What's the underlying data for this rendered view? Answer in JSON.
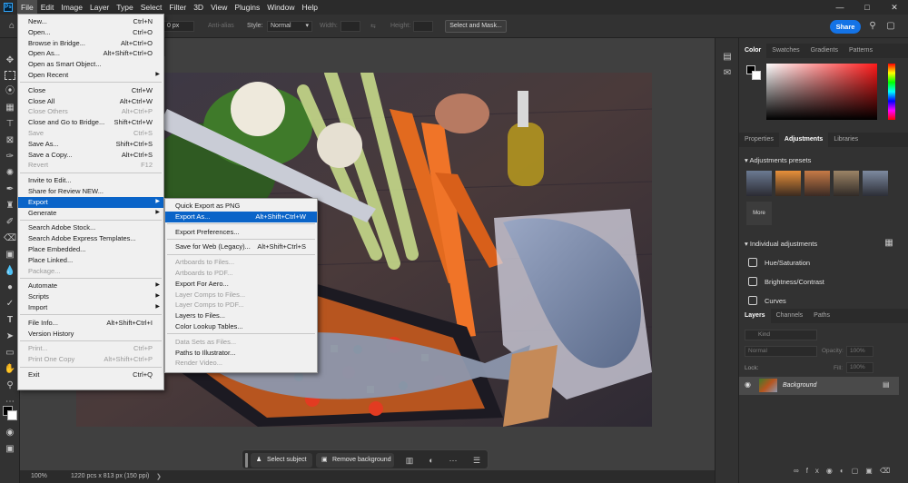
{
  "menubar": {
    "items": [
      "File",
      "Edit",
      "Image",
      "Layer",
      "Type",
      "Select",
      "Filter",
      "3D",
      "View",
      "Plugins",
      "Window",
      "Help"
    ],
    "active": "File"
  },
  "options_bar": {
    "feather_value": "0 px",
    "anti_alias": "Anti-alias",
    "style_label": "Style:",
    "style_value": "Normal",
    "width_label": "Width:",
    "height_label": "Height:",
    "select_mask": "Select and Mask...",
    "share": "Share"
  },
  "file_menu": [
    {
      "label": "New...",
      "key": "Ctrl+N"
    },
    {
      "label": "Open...",
      "key": "Ctrl+O"
    },
    {
      "label": "Browse in Bridge...",
      "key": "Alt+Ctrl+O"
    },
    {
      "label": "Open As...",
      "key": "Alt+Shift+Ctrl+O"
    },
    {
      "label": "Open as Smart Object..."
    },
    {
      "label": "Open Recent",
      "submenu": true
    },
    {
      "sep": true
    },
    {
      "label": "Close",
      "key": "Ctrl+W"
    },
    {
      "label": "Close All",
      "key": "Alt+Ctrl+W"
    },
    {
      "label": "Close Others",
      "key": "Alt+Ctrl+P",
      "disabled": true
    },
    {
      "label": "Close and Go to Bridge...",
      "key": "Shift+Ctrl+W"
    },
    {
      "label": "Save",
      "key": "Ctrl+S",
      "disabled": true
    },
    {
      "label": "Save As...",
      "key": "Shift+Ctrl+S"
    },
    {
      "label": "Save a Copy...",
      "key": "Alt+Ctrl+S"
    },
    {
      "label": "Revert",
      "key": "F12",
      "disabled": true
    },
    {
      "sep": true
    },
    {
      "label": "Invite to Edit..."
    },
    {
      "label": "Share for Review NEW..."
    },
    {
      "label": "Export",
      "submenu": true,
      "highlight": true
    },
    {
      "label": "Generate",
      "submenu": true
    },
    {
      "sep": true
    },
    {
      "label": "Search Adobe Stock..."
    },
    {
      "label": "Search Adobe Express Templates..."
    },
    {
      "label": "Place Embedded..."
    },
    {
      "label": "Place Linked..."
    },
    {
      "label": "Package...",
      "disabled": true
    },
    {
      "sep": true
    },
    {
      "label": "Automate",
      "submenu": true
    },
    {
      "label": "Scripts",
      "submenu": true
    },
    {
      "label": "Import",
      "submenu": true
    },
    {
      "sep": true
    },
    {
      "label": "File Info...",
      "key": "Alt+Shift+Ctrl+I"
    },
    {
      "label": "Version History"
    },
    {
      "sep": true
    },
    {
      "label": "Print...",
      "key": "Ctrl+P",
      "disabled": true
    },
    {
      "label": "Print One Copy",
      "key": "Alt+Shift+Ctrl+P",
      "disabled": true
    },
    {
      "sep": true
    },
    {
      "label": "Exit",
      "key": "Ctrl+Q"
    }
  ],
  "export_menu": [
    {
      "label": "Quick Export as PNG"
    },
    {
      "label": "Export As...",
      "key": "Alt+Shift+Ctrl+W",
      "highlight": true
    },
    {
      "sep": true
    },
    {
      "label": "Export Preferences..."
    },
    {
      "sep": true
    },
    {
      "label": "Save for Web (Legacy)...",
      "key": "Alt+Shift+Ctrl+S"
    },
    {
      "sep": true
    },
    {
      "label": "Artboards to Files...",
      "disabled": true
    },
    {
      "label": "Artboards to PDF...",
      "disabled": true
    },
    {
      "label": "Export For Aero..."
    },
    {
      "label": "Layer Comps to Files...",
      "disabled": true
    },
    {
      "label": "Layer Comps to PDF...",
      "disabled": true
    },
    {
      "label": "Layers to Files..."
    },
    {
      "label": "Color Lookup Tables..."
    },
    {
      "sep": true
    },
    {
      "label": "Data Sets as Files...",
      "disabled": true
    },
    {
      "label": "Paths to Illustrator..."
    },
    {
      "label": "Render Video...",
      "disabled": true
    }
  ],
  "status_bar": {
    "zoom": "100%",
    "doc_size": "1220 pcs x 813 px (150 ppi)"
  },
  "context_bar": {
    "select_subject": "Select subject",
    "remove_background": "Remove background"
  },
  "color_panel": {
    "tabs": [
      "Color",
      "Swatches",
      "Gradients",
      "Patterns"
    ],
    "active_tab": "Color",
    "hue_color": "#ff1a1a"
  },
  "adjustments_panel": {
    "tabs": [
      "Properties",
      "Adjustments",
      "Libraries"
    ],
    "active_tab": "Adjustments",
    "presets_heading": "Adjustments presets",
    "more_label": "More",
    "individual_heading": "Individual adjustments",
    "items": [
      "Hue/Saturation",
      "Brightness/Contrast",
      "Curves"
    ]
  },
  "layers_panel": {
    "tabs": [
      "Layers",
      "Channels",
      "Paths"
    ],
    "active_tab": "Layers",
    "kind_placeholder": "Kind",
    "blend_mode": "Normal",
    "opacity_label": "Opacity:",
    "opacity_value": "100%",
    "lock_label": "Lock:",
    "fill_label": "Fill:",
    "fill_value": "100%",
    "layers": [
      {
        "name": "Background"
      }
    ]
  }
}
